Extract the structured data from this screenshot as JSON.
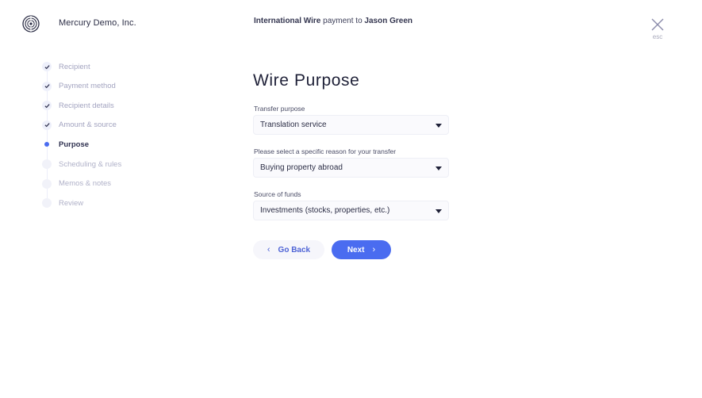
{
  "header": {
    "company": "Mercury Demo, Inc.",
    "title_bold_1": "International Wire",
    "title_mid": " payment to ",
    "title_bold_2": "Jason Green",
    "close_label": "esc"
  },
  "stepper": {
    "steps": [
      {
        "label": "Recipient",
        "state": "done"
      },
      {
        "label": "Payment method",
        "state": "done"
      },
      {
        "label": "Recipient details",
        "state": "done"
      },
      {
        "label": "Amount & source",
        "state": "done"
      },
      {
        "label": "Purpose",
        "state": "current"
      },
      {
        "label": "Scheduling & rules",
        "state": "todo"
      },
      {
        "label": "Memos & notes",
        "state": "todo"
      },
      {
        "label": "Review",
        "state": "todo"
      }
    ]
  },
  "form": {
    "title": "Wire Purpose",
    "fields": [
      {
        "label": "Transfer purpose",
        "value": "Translation service"
      },
      {
        "label": "Please select a specific reason for your transfer",
        "value": "Buying property abroad"
      },
      {
        "label": "Source of funds",
        "value": "Investments (stocks, properties, etc.)"
      }
    ],
    "back_label": "Go Back",
    "next_label": "Next"
  },
  "colors": {
    "accent": "#4a6cf0",
    "check": "#2f3150"
  }
}
